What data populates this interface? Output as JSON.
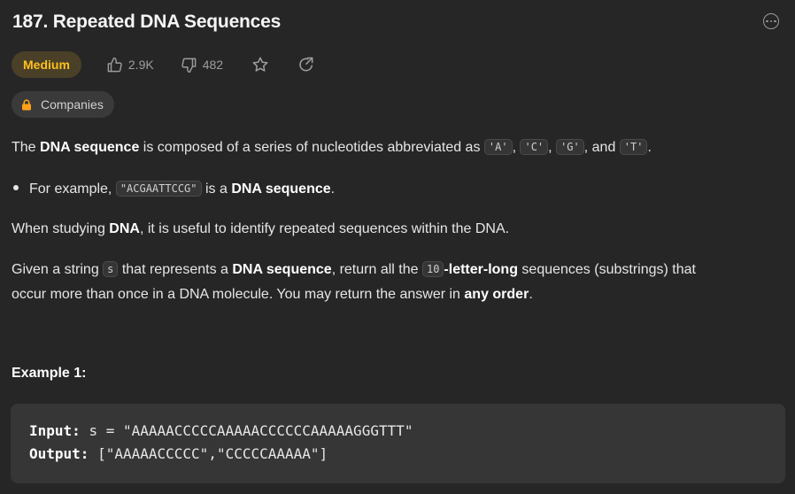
{
  "problem": {
    "title": "187. Repeated DNA Sequences",
    "difficulty": "Medium",
    "likes": "2.9K",
    "dislikes": "482",
    "companies_label": "Companies"
  },
  "description": {
    "p1": {
      "t1": "The ",
      "b1": "DNA sequence",
      "t2": " is composed of a series of nucleotides abbreviated as ",
      "c1": "'A'",
      "t3": ", ",
      "c2": "'C'",
      "t4": ", ",
      "c3": "'G'",
      "t5": ", and ",
      "c4": "'T'",
      "t6": "."
    },
    "bullet": {
      "t1": "For example, ",
      "c1": "\"ACGAATTCCG\"",
      "t2": " is a ",
      "b1": "DNA sequence",
      "t3": "."
    },
    "p2": {
      "t1": "When studying ",
      "b1": "DNA",
      "t2": ", it is useful to identify repeated sequences within the DNA."
    },
    "p3": {
      "t1": "Given a string ",
      "c1": "s",
      "t2": " that represents a ",
      "b1": "DNA sequence",
      "t3": ", return all the ",
      "c2": "10",
      "b2": "-letter-long",
      "t4": " sequences (substrings) that",
      "line2_t1": "occur more than once in a DNA molecule. You may return the answer in ",
      "line2_b1": "any order",
      "line2_t2": "."
    }
  },
  "example": {
    "title": "Example 1:",
    "input_label": "Input:",
    "input_value": "s = \"AAAAACCCCCAAAAACCCCCCAAAAAGGGTTT\"",
    "output_label": "Output:",
    "output_value": "[\"AAAAACCCCC\",\"CCCCCAAAAA\"]"
  },
  "icons": {
    "more": "more-options-icon",
    "like": "thumbs-up-icon",
    "dislike": "thumbs-down-icon",
    "star": "star-icon",
    "share": "share-icon",
    "lock": "lock-icon"
  },
  "colors": {
    "background": "#262626",
    "difficulty_text": "#ffc01e",
    "difficulty_bg": "#4a4028",
    "lock": "#ffa116"
  }
}
